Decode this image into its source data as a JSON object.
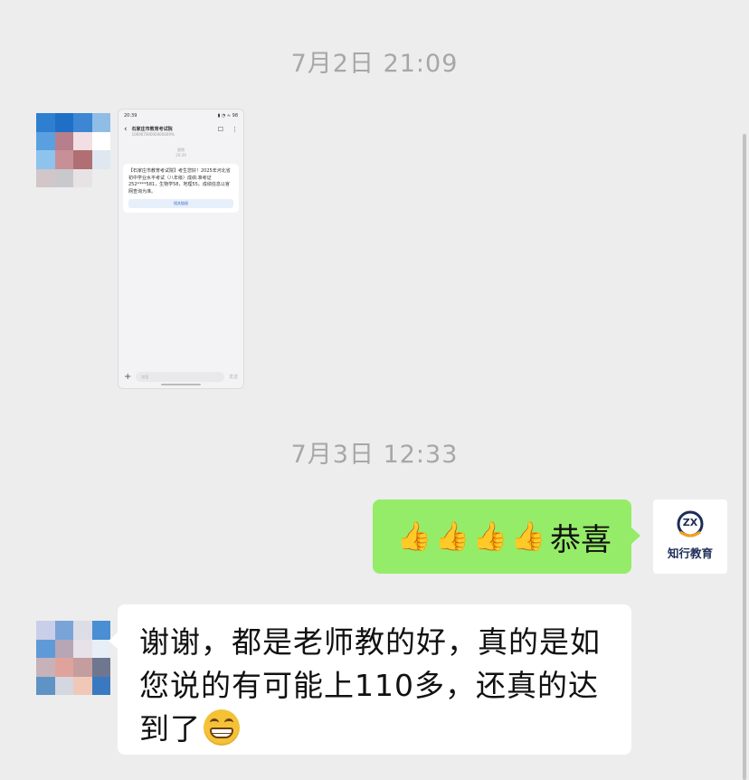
{
  "timestamps": [
    "7月2日 21:09",
    "7月3日 12:33"
  ],
  "sms_screenshot": {
    "status_time": "20:39",
    "status_icons": "▮ ◔ ≈ 98",
    "sender_name": "石家庄市教育考试院",
    "sender_number": "10690700000000409%",
    "date_line1": "星期",
    "date_line2": "20:39",
    "message": "【石家庄市教育考试院】考生您好！2025年河北省初中学业水平考试（八年级）成绩:准考证252****581，生物学58，地理55。成绩信息以官网查询为准。",
    "link_label": "相关链接",
    "input_placeholder": "短信",
    "send_label": "发送"
  },
  "outgoing": {
    "thumb_icon": "thumbs-up-icon",
    "thumb_count": 4,
    "text": "恭喜"
  },
  "logo": {
    "mark": "ZX",
    "name": "知行教育"
  },
  "incoming": {
    "text": "谢谢，都是老师教的好，真的是如您说的有可能上110多，还真的达到了",
    "emoji_icon": "grinning-face-icon"
  },
  "colors": {
    "background": "#ededed",
    "outgoing_bubble": "#95ec69",
    "incoming_bubble": "#ffffff",
    "timestamp": "#a7a7a7"
  }
}
